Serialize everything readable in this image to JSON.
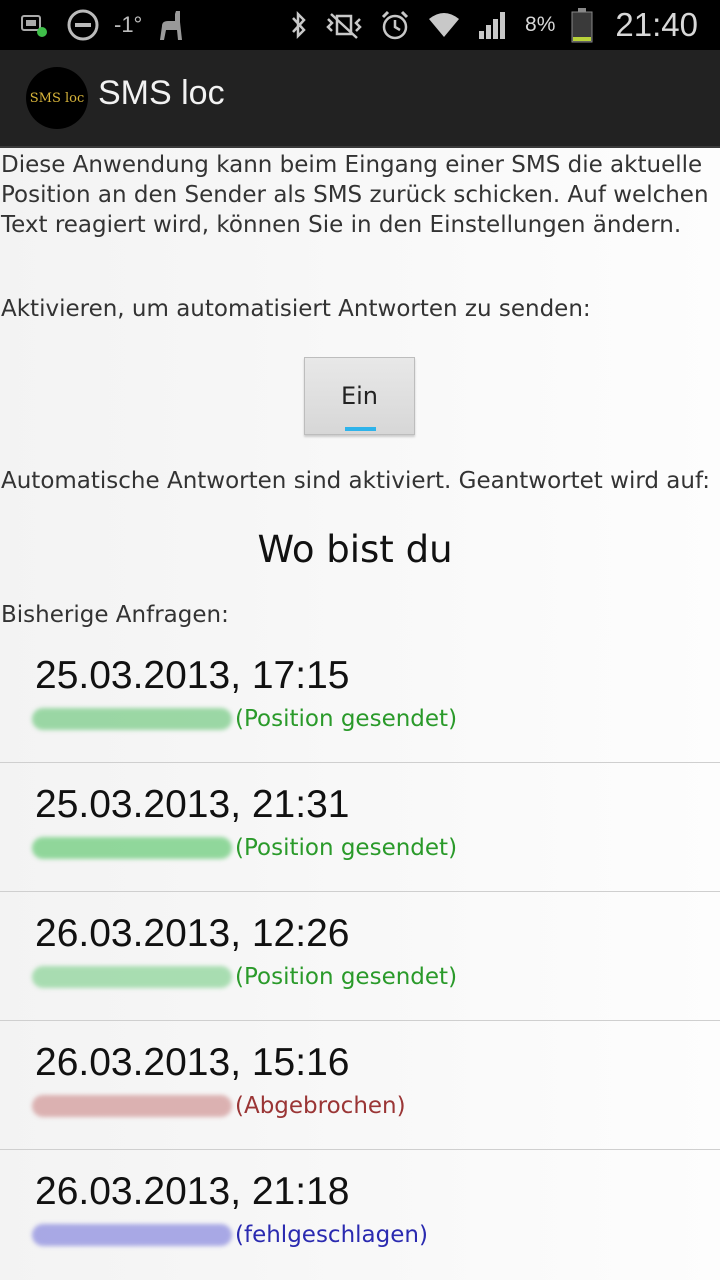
{
  "statusbar": {
    "temperature": "-1°",
    "battery_percent": "8%",
    "time": "21:40",
    "icons": [
      "sim-icon",
      "do-not-disturb-icon",
      "weather-icon",
      "llama-icon",
      "bluetooth-icon",
      "vibrate-icon",
      "alarm-icon",
      "wifi-icon",
      "signal-icon",
      "battery-icon"
    ]
  },
  "appbar": {
    "logo_text": "SMS loc",
    "title": "SMS loc"
  },
  "main": {
    "description": "Diese Anwendung kann beim Eingang einer SMS die aktuelle Position an den Sender als SMS zurück schicken. Auf welchen Text reagiert wird, können Sie in den Einstellungen ändern.",
    "activate_label": "Aktivieren, um automatisiert Antworten zu senden:",
    "toggle_label": "Ein",
    "status_text": "Automatische Antworten sind aktiviert. Geantwortet wird auf:",
    "trigger_text": "Wo bist du",
    "history_label": "Bisherige Anfragen:"
  },
  "history": [
    {
      "date": "25.03.2013, 17:15",
      "status": "(Position gesendet)",
      "status_color": "#2a9a2a",
      "blur_color": "#7dcd8a"
    },
    {
      "date": "25.03.2013, 21:31",
      "status": "(Position gesendet)",
      "status_color": "#2a9a2a",
      "blur_color": "#6fcd7d"
    },
    {
      "date": "26.03.2013, 12:26",
      "status": "(Position gesendet)",
      "status_color": "#2a9a2a",
      "blur_color": "#8fd59b"
    },
    {
      "date": "26.03.2013, 15:16",
      "status": "(Abgebrochen)",
      "status_color": "#9a3535",
      "blur_color": "#d39b9b"
    },
    {
      "date": "26.03.2013, 21:18",
      "status": "(fehlgeschlagen)",
      "status_color": "#2a2ab0",
      "blur_color": "#8f8fe0"
    }
  ],
  "colors": {
    "accent": "#2eb3ea",
    "appbar": "#222222",
    "statusbar": "#000000"
  }
}
